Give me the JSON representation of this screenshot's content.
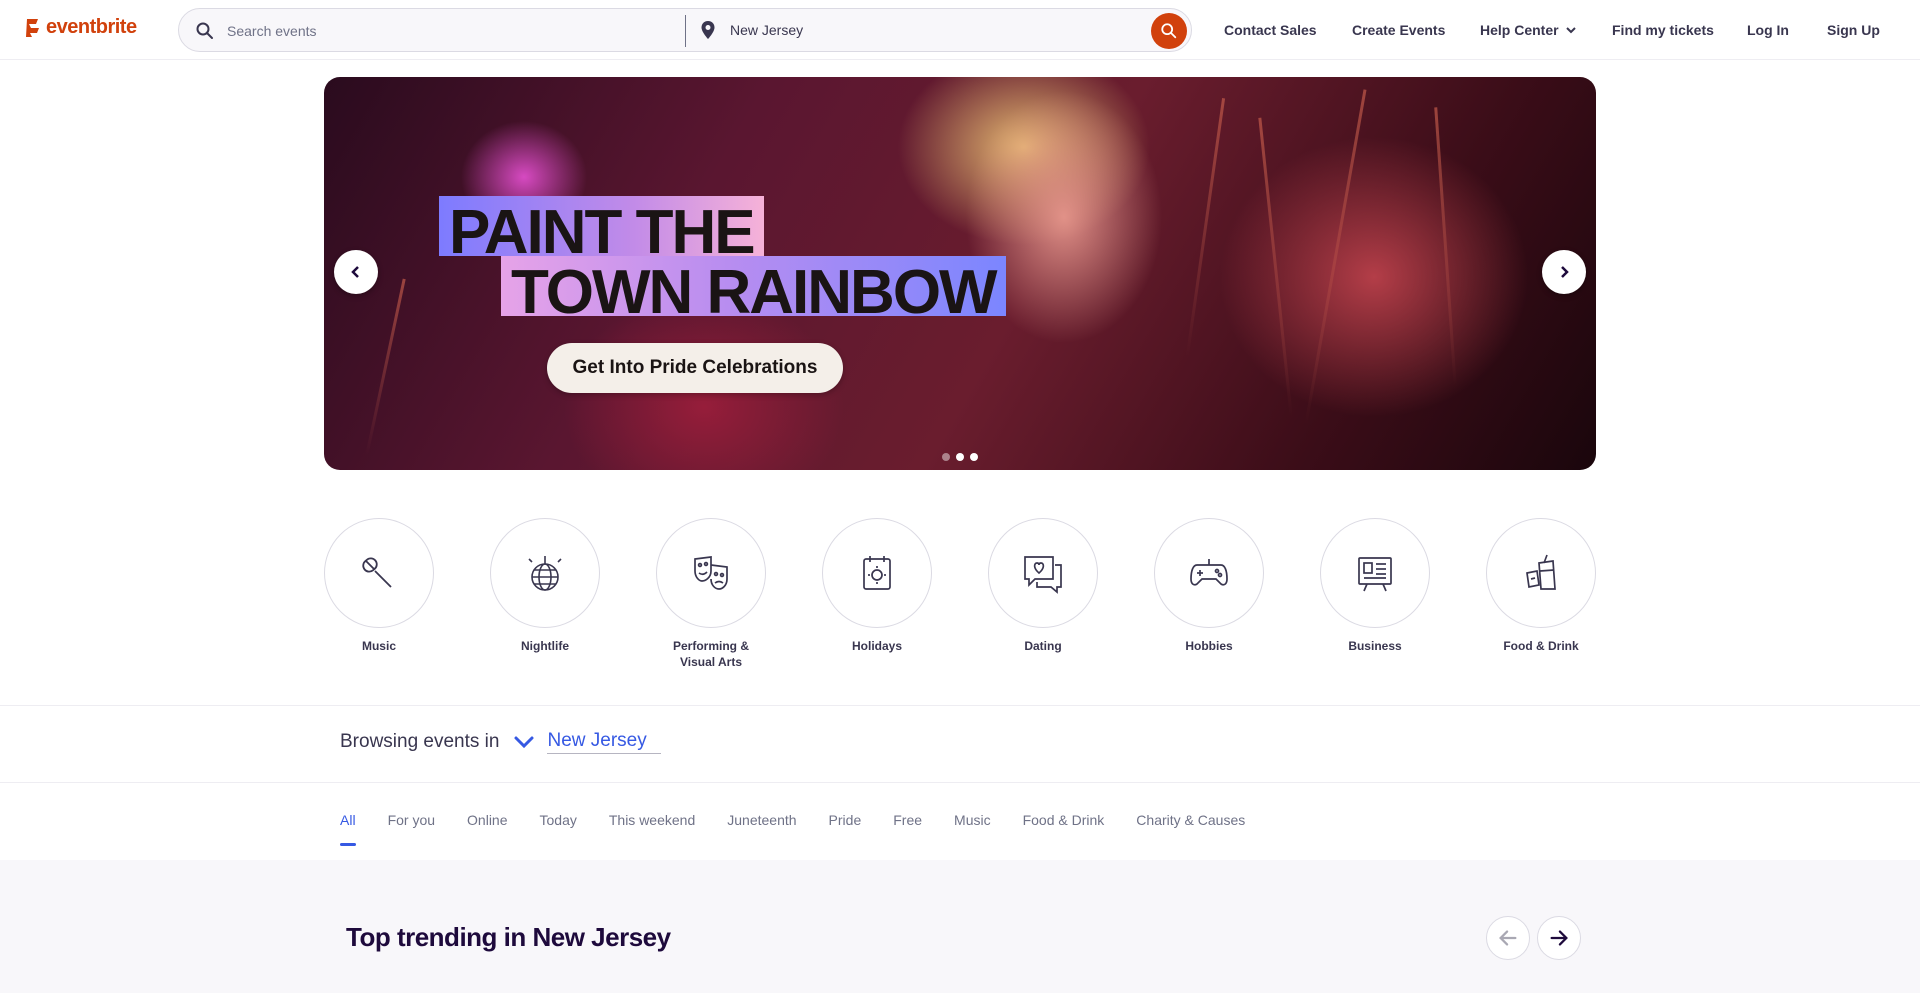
{
  "header": {
    "logo_text": "eventbrite",
    "search_placeholder": "Search events",
    "location": "New Jersey",
    "nav": [
      {
        "label": "Contact Sales"
      },
      {
        "label": "Create Events"
      },
      {
        "label": "Help Center"
      },
      {
        "label": "Find my tickets"
      },
      {
        "label": "Log In"
      },
      {
        "label": "Sign Up"
      }
    ]
  },
  "hero": {
    "headline_line1": "PAINT THE",
    "headline_line2": "TOWN RAINBOW",
    "cta": "Get Into Pride Celebrations",
    "slide_count": 3,
    "active_slide": 1
  },
  "categories": [
    {
      "label": "Music",
      "icon": "microphone-icon"
    },
    {
      "label": "Nightlife",
      "icon": "disco-ball-icon"
    },
    {
      "label": "Performing & Visual Arts",
      "icon": "theater-masks-icon"
    },
    {
      "label": "Holidays",
      "icon": "calendar-sun-icon"
    },
    {
      "label": "Dating",
      "icon": "chat-heart-icon"
    },
    {
      "label": "Hobbies",
      "icon": "gamepad-icon"
    },
    {
      "label": "Business",
      "icon": "presentation-icon"
    },
    {
      "label": "Food & Drink",
      "icon": "drinks-icon"
    }
  ],
  "browsing": {
    "prefix": "Browsing events in",
    "location": "New Jersey"
  },
  "tabs": [
    {
      "label": "All",
      "active": true
    },
    {
      "label": "For you"
    },
    {
      "label": "Online"
    },
    {
      "label": "Today"
    },
    {
      "label": "This weekend"
    },
    {
      "label": "Juneteenth"
    },
    {
      "label": "Pride"
    },
    {
      "label": "Free"
    },
    {
      "label": "Music"
    },
    {
      "label": "Food & Drink"
    },
    {
      "label": "Charity & Causes"
    }
  ],
  "trending": {
    "title": "Top trending in New Jersey"
  },
  "colors": {
    "brand": "#d1410c",
    "link_blue": "#3659e3",
    "text_dark": "#1e0a3c"
  }
}
